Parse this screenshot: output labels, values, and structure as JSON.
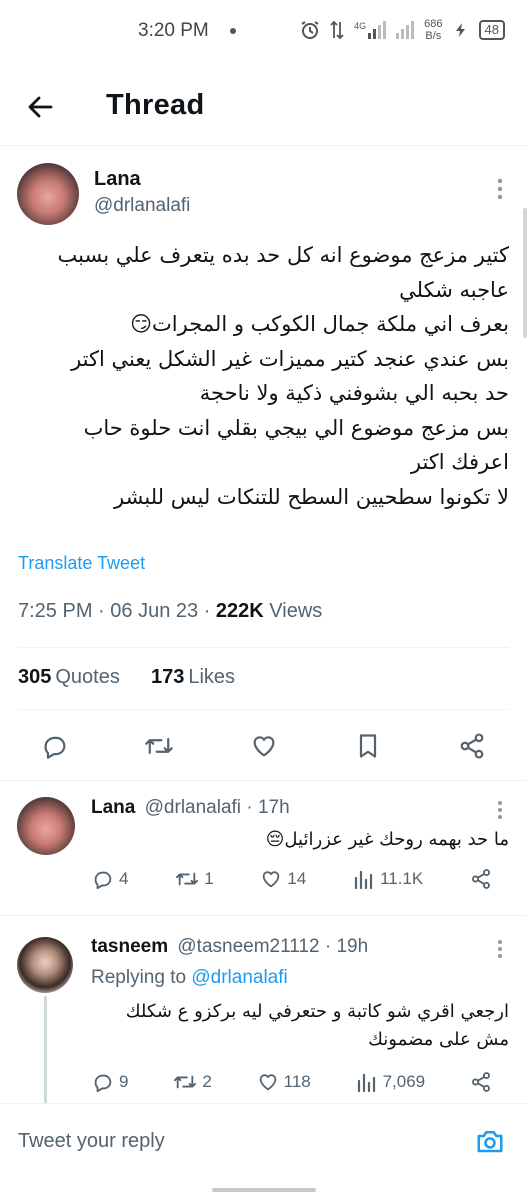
{
  "status_bar": {
    "time": "3:20 PM",
    "net_type": "4G",
    "speed_value": "686",
    "speed_unit": "B/s",
    "battery": "48"
  },
  "header": {
    "title": "Thread"
  },
  "main_tweet": {
    "name": "Lana",
    "handle": "@drlanalafi",
    "text_lines": [
      "كتير مزعج موضوع انه كل حد بده يتعرف علي بسبب",
      "عاجبه شكلي",
      "بعرف اني ملكة جمال الكوكب و المجرات😏",
      "بس عندي عنجد كتير مميزات غير الشكل يعني اكتر",
      "حد بحبه الي بشوفني ذكية ولا ناحجة",
      "بس مزعج موضوع الي بيجي بقلي انت حلوة حاب",
      "اعرفك اكتر",
      "لا تكونوا سطحيين السطح للتنكات ليس للبشر"
    ],
    "translate_label": "Translate Tweet",
    "time": "7:25 PM",
    "date": "06 Jun 23",
    "views_count": "222K",
    "views_label": "Views",
    "quotes_count": "305",
    "quotes_label": "Quotes",
    "likes_count": "173",
    "likes_label": "Likes"
  },
  "replies": [
    {
      "name": "Lana",
      "handle": "@drlanalafi",
      "age": "17h",
      "text_lines": [
        "ما حد بهمه روحك غير عزرائيل😔"
      ],
      "replies": "4",
      "retweets": "1",
      "likes": "14",
      "views": "11.1K"
    },
    {
      "name": "tasneem",
      "handle": "@tasneem21112",
      "age": "19h",
      "replying_prefix": "Replying to",
      "replying_to": "@drlanalafi",
      "text_lines": [
        "ارجعي اقري شو كاتبة و حتعرفي ليه بركزو ع شكلك",
        "مش على مضمونك"
      ],
      "replies": "9",
      "retweets": "2",
      "likes": "118",
      "views": "7,069"
    }
  ],
  "composer": {
    "placeholder": "Tweet your reply"
  },
  "colors": {
    "accent": "#1d9bf0",
    "secondary_text": "#536471",
    "divider": "#eff3f4"
  },
  "icons": [
    "back-arrow-icon",
    "more-icon",
    "reply-icon",
    "retweet-icon",
    "like-icon",
    "bookmark-icon",
    "share-icon",
    "views-icon",
    "camera-icon"
  ]
}
